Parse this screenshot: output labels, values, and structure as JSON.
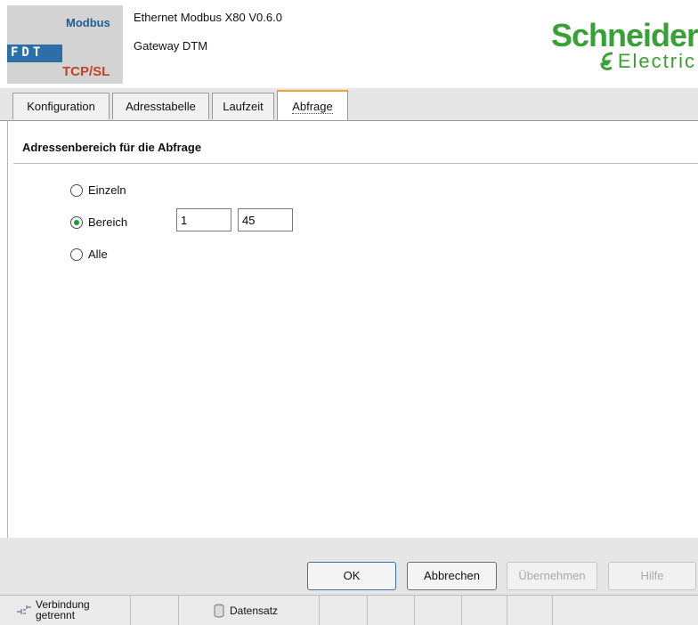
{
  "header": {
    "logo": {
      "modbus": "Modbus",
      "fdt": "FDT",
      "tcp": "TCP/SL"
    },
    "product_name": "Ethernet Modbus X80 V0.6.0",
    "product_sub": "Gateway DTM",
    "brand": {
      "name_top": "Schneider",
      "name_bottom": "Electric",
      "color": "#3aa035"
    }
  },
  "tabs": [
    {
      "label": "Konfiguration",
      "active": false
    },
    {
      "label": "Adresstabelle",
      "active": false
    },
    {
      "label": "Laufzeit",
      "active": false
    },
    {
      "label": "Abfrage",
      "active": true
    }
  ],
  "content": {
    "section_title": "Adressenbereich für die Abfrage",
    "options": [
      {
        "label": "Einzeln",
        "checked": false
      },
      {
        "label": "Bereich",
        "checked": true
      },
      {
        "label": "Alle",
        "checked": false
      }
    ],
    "range_start": "1",
    "range_end": "45"
  },
  "buttons": {
    "ok": "OK",
    "cancel": "Abbrechen",
    "apply": "Übernehmen",
    "help": "Hilfe"
  },
  "statusbar": {
    "connection_line1": "Verbindung",
    "connection_line2": "getrennt",
    "dataset": "Datensatz"
  },
  "colors": {
    "accent_tab": "#f0a236",
    "radio_dot": "#1e9a37",
    "fdt_blue": "#2b6ea8",
    "tcp_red": "#c34227"
  }
}
